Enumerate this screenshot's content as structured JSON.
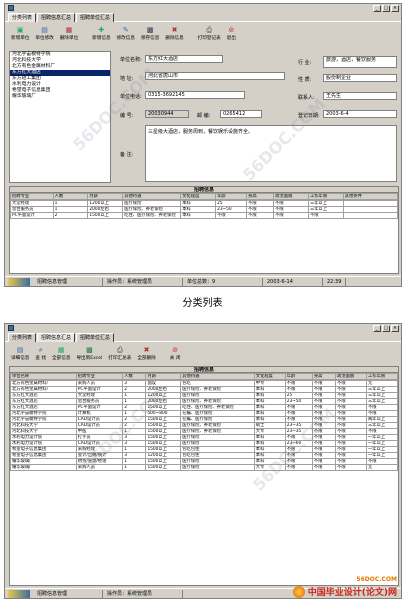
{
  "window1": {
    "tabs": [
      "分类列表",
      "招聘信息汇总",
      "招聘单位汇总"
    ],
    "toolbar": [
      "新增单位",
      "单位修改",
      "删除单位",
      "新增信息",
      "修改信息",
      "保存信息",
      "删除信息",
      "打印登记表",
      "退出"
    ],
    "units": [
      "河北宇宙模特学院",
      "河北科技大学",
      "北方有色金属材料厂",
      "东方红大酒店",
      "东方轻工集团",
      "水利电力设计",
      "希望电子信息集团",
      "耀华玻璃厂"
    ],
    "selected_unit": 3,
    "form": {
      "name_label": "单位名称:",
      "name_value": "东方红大酒店",
      "industry_label": "行 业:",
      "industry_value": "旅游，酒店，餐饮服务",
      "address_label": "地 址:",
      "address_value": "河北省唐山市",
      "nature_label": "性 质:",
      "nature_value": "股份制企业",
      "phone_label": "单位电话:",
      "phone_value": "0315-3692145",
      "contact_label": "联系人:",
      "contact_value": "王先生",
      "id_label": "编 号:",
      "id_value": "20030944",
      "code_label": "邮 编:",
      "code_value": "0265412",
      "date_label": "登记日期:",
      "date_value": "2003-6-4",
      "remark_label": "备 注:",
      "remark_value": "三星级大酒店，服务周到，餐饮娱乐设施齐全。"
    },
    "grid": {
      "title": "招聘信息",
      "headers": [
        "招聘专业",
        "人数",
        "月薪",
        "其他待遇",
        "文化程度",
        "年龄",
        "身高",
        "政治面貌",
        "工作年限",
        "其他条件"
      ],
      "rows": [
        [
          "大堂经理",
          "1",
          "1200以上",
          "医疗保险",
          "本科",
          "25",
          "不限",
          "不限",
          "三年以上",
          ""
        ],
        [
          "总台服务员",
          "1",
          "2000左右",
          "医疗保险、养老保险",
          "本科",
          "23~50",
          "不限",
          "不限",
          "三年以上",
          ""
        ],
        [
          "PC平面设计",
          "2",
          "1500以上",
          "吃住、医疗保险、养老保险",
          "本科",
          "不限",
          "不限",
          "不限",
          "不限",
          ""
        ]
      ]
    },
    "status": [
      "招聘信息管理",
      "操作员：系统管理员",
      "单位总数：9",
      "2003-6-14",
      "22:39"
    ]
  },
  "caption": "分类列表",
  "window2": {
    "tabs": [
      "分类列表",
      "招聘信息汇总",
      "招聘单位汇总"
    ],
    "toolbar": [
      "详细信息",
      "查 找",
      "全部信息",
      "导出到Excel",
      "打印汇总表",
      "全部删除",
      "关 闭"
    ],
    "grid": {
      "title": "招聘信息",
      "headers": [
        "单位名称",
        "招聘专业",
        "人数",
        "月薪",
        "其他待遇",
        "文化程度",
        "年龄",
        "身高",
        "政治面貌",
        "工作年限"
      ],
      "rows": [
        [
          "北方有色金属材料厂",
          "采购人员",
          "3",
          "面议",
          "包吃",
          "中专",
          "不限",
          "不限",
          "不限",
          "无"
        ],
        [
          "北方有色金属材料厂",
          "PC平面设计",
          "2",
          "2000左右",
          "医疗保险、养老保险",
          "本科",
          "不限",
          "不限",
          "不限",
          "三年以上"
        ],
        [
          "东方红大酒店",
          "大堂经理",
          "1",
          "1200以上",
          "医疗保险",
          "本科",
          "25",
          "不限",
          "不限",
          "三年以上"
        ],
        [
          "东方红大酒店",
          "总台服务员",
          "1",
          "2000左右",
          "医疗保险、养老保险",
          "本科",
          "23~50",
          "不限",
          "不限",
          "三年以上"
        ],
        [
          "东方红大酒店",
          "PC平面设计",
          "2",
          "1500以上",
          "吃住、医疗保险、养老保险",
          "本科",
          "不限",
          "不限",
          "不限",
          "不限"
        ],
        [
          "河北宇宙模特学院",
          "计算机",
          "1",
          "500~800",
          "在编、医疗保险",
          "本科",
          "不限",
          "不限",
          "不限",
          "不限"
        ],
        [
          "河北宇宙模特学院",
          "CAD设计员",
          "2",
          "1500以上",
          "在编、医疗保险",
          "本科",
          "不限",
          "不限",
          "不限",
          "两年以上"
        ],
        [
          "河北科技大学",
          "CAD设计员",
          "2",
          "1500以上",
          "医疗保险、养老保险",
          "硕士",
          "23~35",
          "不限",
          "不限",
          "三年以上"
        ],
        [
          "河北科技大学",
          "中医",
          "1",
          "1500以上",
          "医疗保险、养老保险",
          "大专",
          "23~35",
          "不限",
          "不限",
          "不限"
        ],
        [
          "水利电力设计院",
          "打字员",
          "3",
          "1500以上",
          "医疗保险",
          "本科",
          "不限",
          "不限",
          "不限",
          "一年以上"
        ],
        [
          "水利电力设计院",
          "CAD设计员",
          "3",
          "1500以上",
          "医疗保险",
          "本科",
          "23~60",
          "不限",
          "不限",
          "一年以上"
        ],
        [
          "希望电子信息集团",
          "采购经理",
          "1",
          "1500以上",
          "包吃包住",
          "本科",
          "不限",
          "不限",
          "不限",
          "一年以上"
        ],
        [
          "希望电子信息集团",
          "会计/出纳/统计",
          "3",
          "1200以上",
          "包吃包住",
          "本科",
          "不限",
          "不限",
          "不限",
          "一年以上"
        ],
        [
          "耀华玻璃厂",
          "财务/管理/经理",
          "1",
          "1500以上",
          "医疗保险",
          "本科",
          "不限",
          "不限",
          "不限",
          "不限"
        ],
        [
          "耀华玻璃厂",
          "采购人员",
          "1",
          "1500以上",
          "医疗保险",
          "大专",
          "不限",
          "不限",
          "不限",
          "无"
        ]
      ]
    },
    "status": [
      "招聘信息管理",
      "操作员：系统管理员"
    ]
  },
  "watermark": "56DOC.COM",
  "brand": {
    "text": "中国毕业设计(论文)网",
    "site": "56DOC.COM"
  }
}
